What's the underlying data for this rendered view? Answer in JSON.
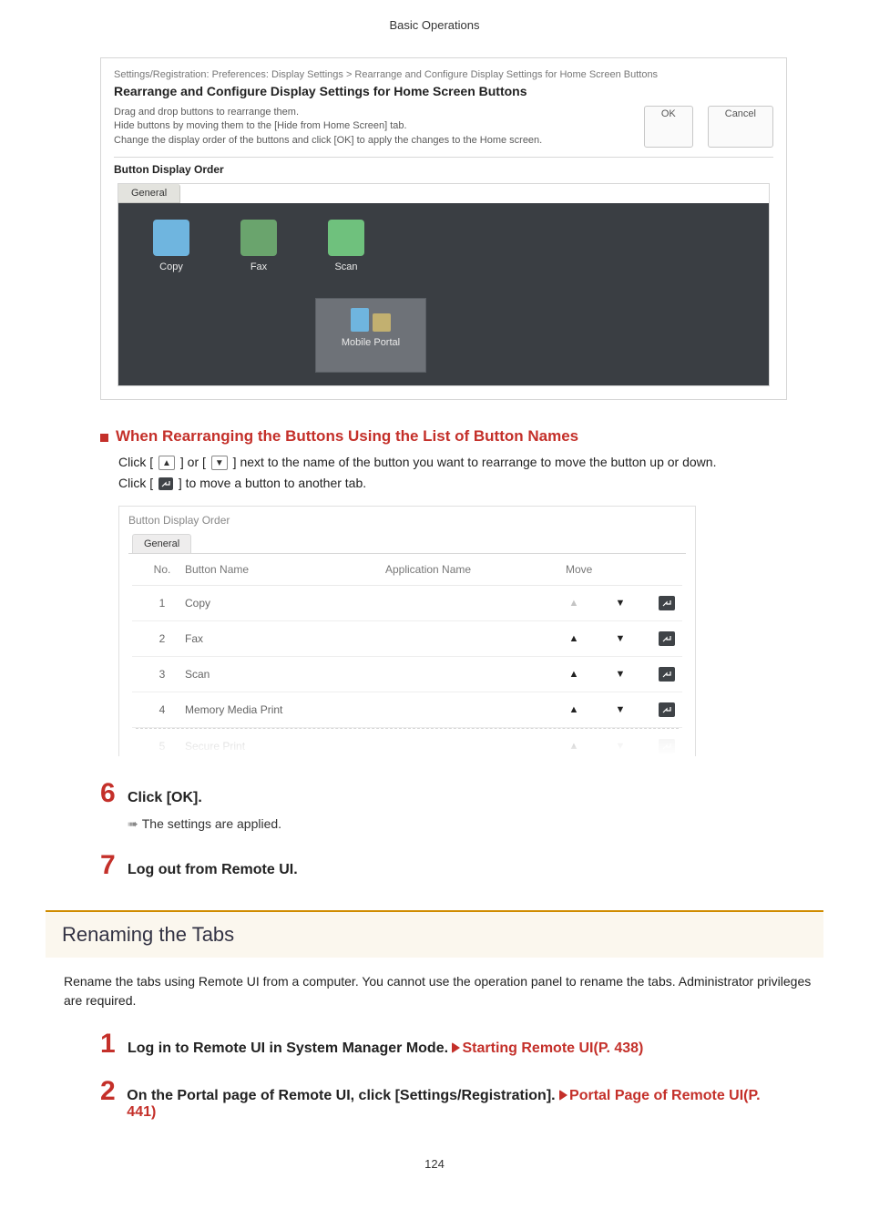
{
  "pageHeader": "Basic Operations",
  "pageNumber": "124",
  "screenshot1": {
    "breadcrumb": "Settings/Registration: Preferences: Display Settings > Rearrange and Configure Display Settings for Home Screen Buttons",
    "title": "Rearrange and Configure Display Settings for Home Screen Buttons",
    "instr1": "Drag and drop buttons to rearrange them.",
    "instr2": "Hide buttons by moving them to the [Hide from Home Screen] tab.",
    "instr3": "Change the display order of the buttons and click [OK] to apply the changes to the Home screen.",
    "ok": "OK",
    "cancel": "Cancel",
    "sectionLabel": "Button Display Order",
    "tab": "General",
    "apps": {
      "copy": "Copy",
      "fax": "Fax",
      "scan": "Scan",
      "mobile": "Mobile Portal"
    }
  },
  "subhead": "When Rearranging the Buttons Using the List of Button Names",
  "para1a": "Click [ ",
  "para1b": " ] or [ ",
  "para1c": " ] next to the name of the button you want to rearrange to move the button up or down.",
  "para2a": "Click [ ",
  "para2b": " ] to move a button to another tab.",
  "screenshot2": {
    "label": "Button Display Order",
    "tab": "General",
    "headers": {
      "no": "No.",
      "name": "Button Name",
      "app": "Application Name",
      "move": "Move"
    },
    "rows": [
      {
        "no": "1",
        "name": "Copy",
        "upDisabled": true,
        "downDisabled": false,
        "moveDisabled": false
      },
      {
        "no": "2",
        "name": "Fax",
        "upDisabled": false,
        "downDisabled": false,
        "moveDisabled": false
      },
      {
        "no": "3",
        "name": "Scan",
        "upDisabled": false,
        "downDisabled": false,
        "moveDisabled": false
      },
      {
        "no": "4",
        "name": "Memory Media Print",
        "upDisabled": false,
        "downDisabled": false,
        "moveDisabled": false
      },
      {
        "no": "5",
        "name": "Secure Print",
        "upDisabled": false,
        "downDisabled": true,
        "moveDisabled": true,
        "faded": true
      }
    ]
  },
  "step6": {
    "num": "6",
    "title": "Click [OK].",
    "sub": "The settings are applied."
  },
  "step7": {
    "num": "7",
    "title": "Log out from Remote UI."
  },
  "section": {
    "title": "Renaming the Tabs",
    "para1": "Rename the tabs using Remote UI from a computer. You cannot use the operation panel to rename the tabs. Administrator privileges are required."
  },
  "stepR1": {
    "num": "1",
    "titleA": "Log in to Remote UI in System Manager Mode. ",
    "link": "Starting Remote UI(P. 438)"
  },
  "stepR2": {
    "num": "2",
    "titleA": "On the Portal page of Remote UI, click [Settings/Registration]. ",
    "link": "Portal Page of Remote UI(P. 441)"
  }
}
